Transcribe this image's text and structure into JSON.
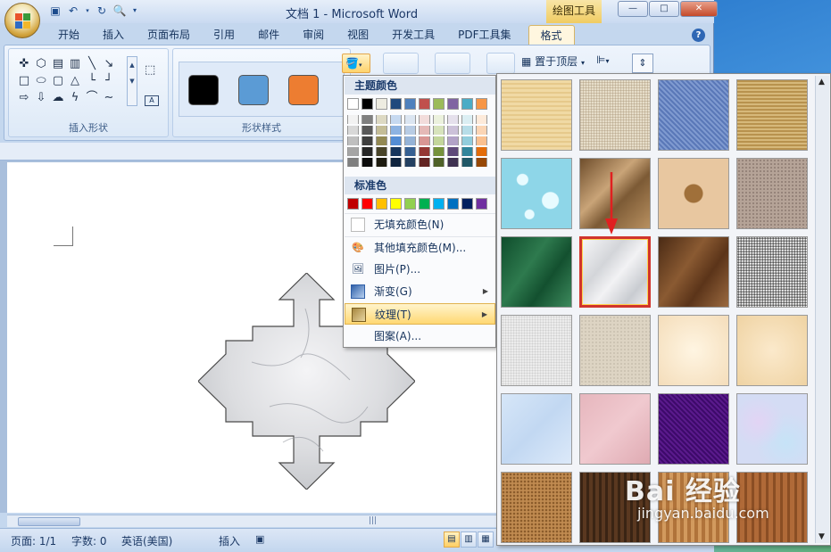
{
  "window": {
    "title": "文档 1 - Microsoft Word",
    "context_tab": "绘图工具",
    "controls": [
      "—",
      "□",
      "✕"
    ]
  },
  "ribbon": {
    "tabs": [
      "开始",
      "插入",
      "页面布局",
      "引用",
      "邮件",
      "审阅",
      "视图",
      "开发工具",
      "PDF工具集",
      "格式"
    ],
    "active_tab": "格式",
    "groups": {
      "insert_shapes": "插入形状",
      "shape_styles": "形状样式"
    },
    "style_swatches": [
      "#000000",
      "#5b9bd5",
      "#ed7d31"
    ],
    "bring_to_front": "置于顶层",
    "help": "?"
  },
  "fill_menu": {
    "theme_colors_header": "主题颜色",
    "standard_colors_header": "标准色",
    "theme_colors": [
      "#ffffff",
      "#000000",
      "#eeece1",
      "#1f497d",
      "#4f81bd",
      "#c0504d",
      "#9bbb59",
      "#8064a2",
      "#4bacc6",
      "#f79646"
    ],
    "theme_shades": [
      [
        "#f2f2f2",
        "#7f7f7f",
        "#ddd9c3",
        "#c6d9f0",
        "#dbe5f1",
        "#f2dcdb",
        "#ebf1dd",
        "#e5e0ec",
        "#dbeef3",
        "#fdeada"
      ],
      [
        "#d8d8d8",
        "#595959",
        "#c4bd97",
        "#8db3e2",
        "#b8cce4",
        "#e5b9b7",
        "#d7e3bc",
        "#ccc1d9",
        "#b7dde8",
        "#fbd5b5"
      ],
      [
        "#bfbfbf",
        "#3f3f3f",
        "#938953",
        "#548dd4",
        "#95b3d7",
        "#d99694",
        "#c3d69b",
        "#b2a2c7",
        "#92cddc",
        "#fac08f"
      ],
      [
        "#a5a5a5",
        "#262626",
        "#494429",
        "#17365d",
        "#366092",
        "#953734",
        "#76923c",
        "#5f497a",
        "#31859b",
        "#e36c09"
      ],
      [
        "#7f7f7f",
        "#0c0c0c",
        "#1d1b10",
        "#0f243e",
        "#244061",
        "#632423",
        "#4f6128",
        "#3f3151",
        "#205867",
        "#974806"
      ]
    ],
    "standard_colors": [
      "#c00000",
      "#ff0000",
      "#ffc000",
      "#ffff00",
      "#92d050",
      "#00b050",
      "#00b0f0",
      "#0070c0",
      "#002060",
      "#7030a0"
    ],
    "items": {
      "no_fill": "无填充颜色(N)",
      "more_colors": "其他填充颜色(M)...",
      "picture": "图片(P)...",
      "gradient": "渐变(G)",
      "texture": "纹理(T)",
      "pattern": "图案(A)..."
    }
  },
  "textures": [
    "papyrus",
    "canvas",
    "denim",
    "woven-mat",
    "water-droplets",
    "paper-bag",
    "fish-fossil",
    "sand",
    "green-marble",
    "white-marble",
    "brown-marble",
    "granite",
    "newsprint",
    "recycled-paper",
    "parchment",
    "stationery",
    "blue-tissue-paper",
    "pink-tissue-paper",
    "purple-mesh",
    "bouquet",
    "cork",
    "walnut",
    "oak",
    "medium-wood"
  ],
  "selected_texture": "white-marble",
  "status": {
    "page": "页面: 1/1",
    "words": "字数: 0",
    "language": "英语(美国)",
    "mode": "插入"
  },
  "watermark": {
    "brand": "Bai 经验",
    "url": "jingyan.baidu.com"
  }
}
